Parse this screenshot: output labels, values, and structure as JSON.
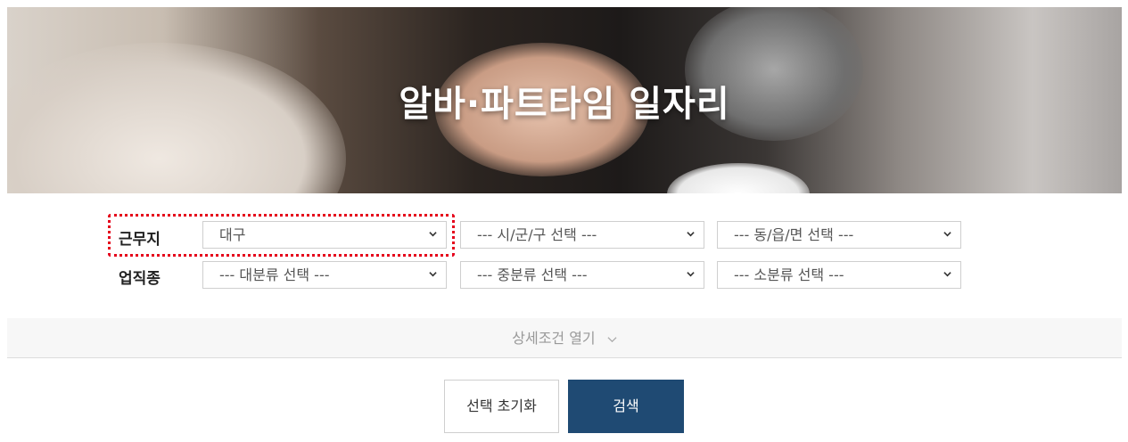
{
  "hero": {
    "title": "알바·파트타임 일자리"
  },
  "filters": {
    "location": {
      "label": "근무지",
      "city": "대구",
      "district": "--- 시/군/구 선택 ---",
      "neighborhood": "--- 동/읍/면 선택 ---"
    },
    "industry": {
      "label": "업직종",
      "major": "--- 대분류 선택 ---",
      "middle": "--- 중분류 선택 ---",
      "minor": "--- 소분류 선택 ---"
    }
  },
  "detail_toggle": {
    "label": "상세조건 열기",
    "icon": "chevron-down-icon"
  },
  "buttons": {
    "reset": "선택 초기화",
    "search": "검색"
  },
  "colors": {
    "accent": "#1f4a73",
    "highlight": "#e5001b"
  }
}
